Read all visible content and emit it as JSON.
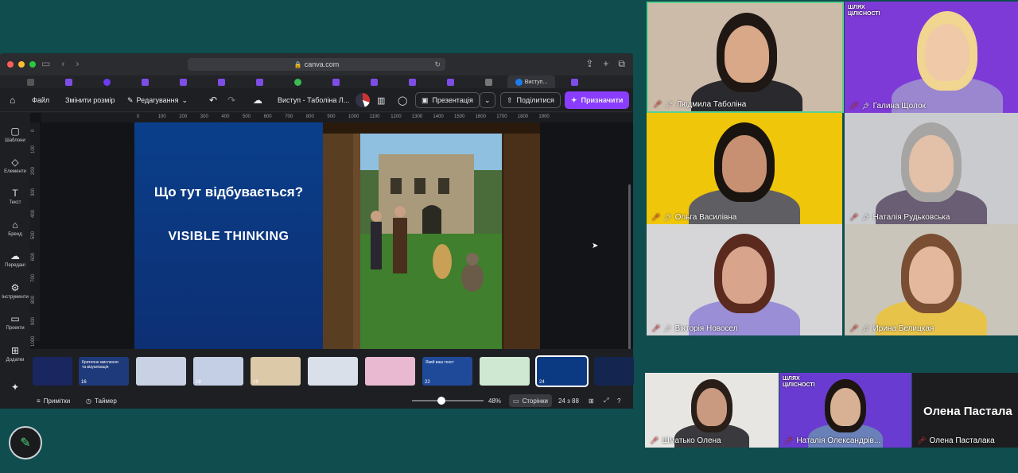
{
  "browser": {
    "url": "canva.com",
    "active_tab_label": "Виступ..."
  },
  "toolbar": {
    "file": "Файл",
    "resize": "Змінити розмір",
    "editing": "Редагування",
    "doc_title": "Виступ - Таболіна Л...",
    "presentation": "Презентація",
    "share": "Поділитися",
    "assign": "Призначити"
  },
  "rail": [
    {
      "label": "Шаблони",
      "icon": "layout-icon"
    },
    {
      "label": "Елементи",
      "icon": "elements-icon"
    },
    {
      "label": "Текст",
      "icon": "text-icon"
    },
    {
      "label": "Бренд",
      "icon": "brand-icon"
    },
    {
      "label": "Передані",
      "icon": "upload-icon"
    },
    {
      "label": "Інструменти",
      "icon": "tools-icon"
    },
    {
      "label": "Проекти",
      "icon": "folder-icon"
    },
    {
      "label": "Додатки",
      "icon": "apps-icon"
    },
    {
      "label": "Magic Media",
      "icon": "magic-icon"
    }
  ],
  "ruler_top": [
    "0",
    "100",
    "200",
    "300",
    "400",
    "500",
    "600",
    "700",
    "800",
    "900",
    "1000",
    "1100",
    "1200",
    "1300",
    "1400",
    "1500",
    "1600",
    "1700",
    "1800",
    "1900"
  ],
  "ruler_left": [
    "0",
    "100",
    "200",
    "300",
    "400",
    "500",
    "600",
    "700",
    "800",
    "900",
    "1000"
  ],
  "slide": {
    "question": "Що тут відбувається?",
    "subtitle": "VISIBLE THINKING"
  },
  "thumbnails": [
    {
      "num": "",
      "color": "#1a2660"
    },
    {
      "num": "16",
      "color": "#1f3a7a",
      "text": "Критичне мислення та візуалізація"
    },
    {
      "num": "",
      "color": "#c8d2e4"
    },
    {
      "num": "18",
      "color": "#c4cfe6"
    },
    {
      "num": "19",
      "color": "#dcc9a8"
    },
    {
      "num": "",
      "color": "#d9e0ea"
    },
    {
      "num": "",
      "color": "#e8b9d0"
    },
    {
      "num": "22",
      "color": "#1f4a9a",
      "text": "Який ваш текст"
    },
    {
      "num": "",
      "color": "#cfe8d2"
    },
    {
      "num": "24",
      "color": "#0c3a82"
    },
    {
      "num": "",
      "color": "#14264f"
    }
  ],
  "status": {
    "notes": "Примітки",
    "timer": "Таймер",
    "zoom": "48%",
    "pages": "Сторінки",
    "page_count": "24 з 88"
  },
  "participants": [
    {
      "name": "Людмила Таболіна",
      "bg": "#cdbbaa",
      "speaking": true
    },
    {
      "name": "Галина Щолок",
      "bg": "#7e3ad6"
    },
    {
      "name": "Ольга Василівна",
      "bg": "#f0c60a"
    },
    {
      "name": "Наталія Рудьковська",
      "bg": "#c9cbcf"
    },
    {
      "name": "Вікторія Новосел",
      "bg": "#d6d6d8"
    },
    {
      "name": "Ирина Белицкая",
      "bg": "#c9c5bb"
    },
    {
      "name": "Шматько Олена",
      "bg": "#e8e6e3"
    },
    {
      "name": "Наталія Олександрів...",
      "bg": "#6a3bd0"
    },
    {
      "name": "Олена Пасталака",
      "bg": "#1d1d1f"
    }
  ],
  "placeholder_name": "Олена Пастала",
  "banner_text": "ШЛЯХ ЦІЛІСНОСТІ"
}
